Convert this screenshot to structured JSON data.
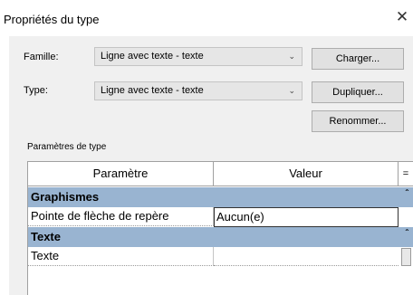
{
  "dialog": {
    "title": "Propriétés du type",
    "close_glyph": "✕"
  },
  "family": {
    "label": "Famille:",
    "value": "Ligne avec texte - texte"
  },
  "type": {
    "label": "Type:",
    "value": "Ligne avec texte - texte"
  },
  "buttons": {
    "load": "Charger...",
    "duplicate": "Dupliquer...",
    "rename": "Renommer..."
  },
  "type_params_label": "Paramètres de type",
  "grid": {
    "headers": {
      "param": "Paramètre",
      "value": "Valeur",
      "extra": "="
    },
    "groups": [
      {
        "name": "Graphismes",
        "rows": [
          {
            "param": "Pointe de flèche de repère",
            "value": "Aucun(e)"
          }
        ]
      },
      {
        "name": "Texte",
        "rows": [
          {
            "param": "Texte",
            "value": ""
          }
        ]
      }
    ]
  },
  "icons": {
    "close": "close-icon",
    "dropdown": "chevron-down-icon",
    "collapse": "caret-up-icon"
  }
}
